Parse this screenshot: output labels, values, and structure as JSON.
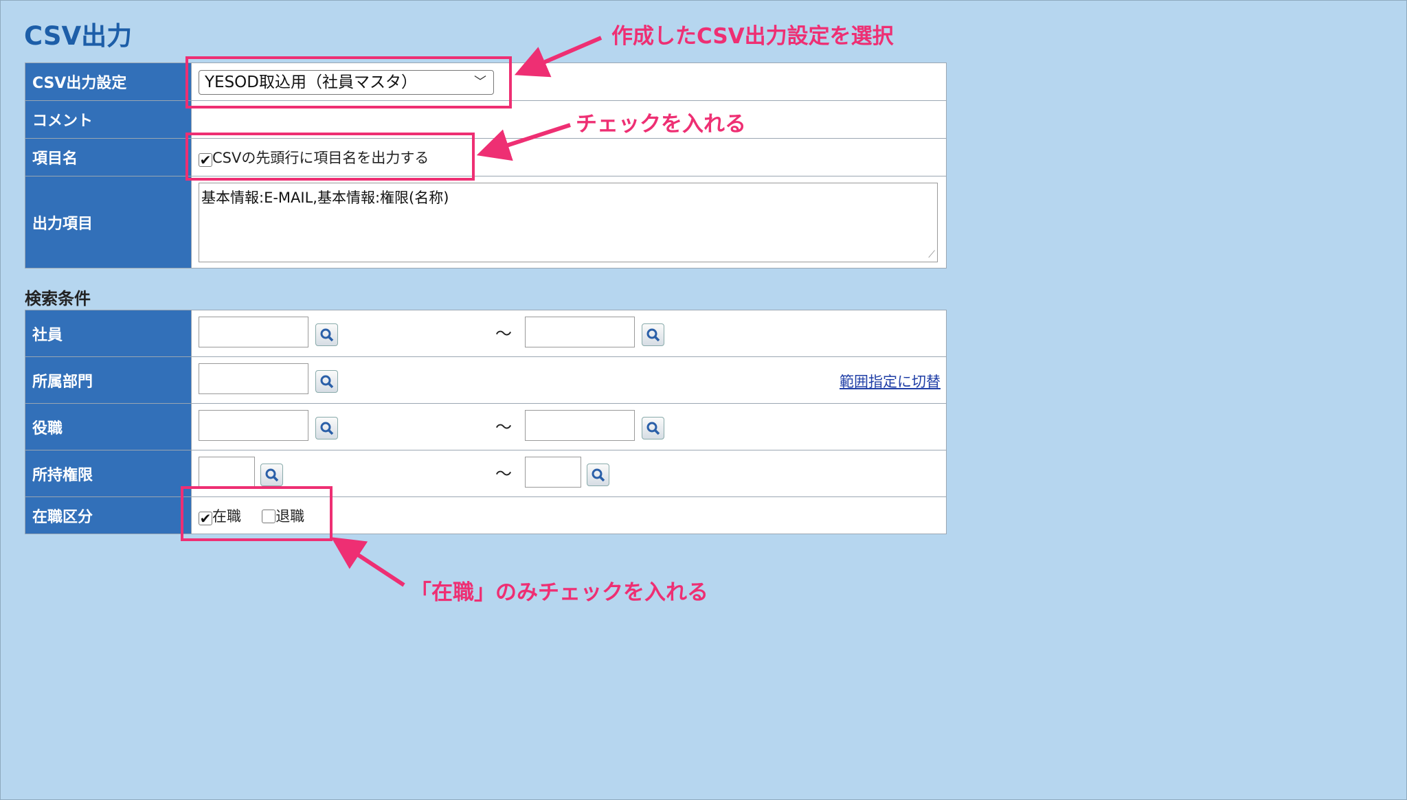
{
  "page": {
    "title": "CSV出力"
  },
  "settings_table": {
    "csv_setting": {
      "label": "CSV出力設定",
      "value": "YESOD取込用（社員マスタ）"
    },
    "comment": {
      "label": "コメント",
      "value": ""
    },
    "item_name": {
      "label": "項目名",
      "checkbox_label": "CSVの先頭行に項目名を出力する",
      "checked": true
    },
    "output_items": {
      "label": "出力項目",
      "value": "基本情報:E-MAIL,基本情報:権限(名称)"
    }
  },
  "search": {
    "title": "検索条件",
    "employee": {
      "label": "社員",
      "tilde": "〜"
    },
    "department": {
      "label": "所属部門",
      "range_link": "範囲指定に切替"
    },
    "position": {
      "label": "役職",
      "tilde": "〜"
    },
    "permission": {
      "label": "所持権限",
      "tilde": "〜"
    },
    "employment": {
      "label": "在職区分",
      "options": [
        {
          "label": "在職",
          "checked": true
        },
        {
          "label": "退職",
          "checked": false
        }
      ]
    }
  },
  "annotations": {
    "select_note": "作成したCSV出力設定を選択",
    "check_note": "チェックを入れる",
    "employment_note": "「在職」のみチェックを入れる",
    "color": "#ee2f73"
  },
  "colors": {
    "background": "#b6d6ef",
    "label_bg": "#3270b9",
    "title": "#1d5ea8"
  }
}
